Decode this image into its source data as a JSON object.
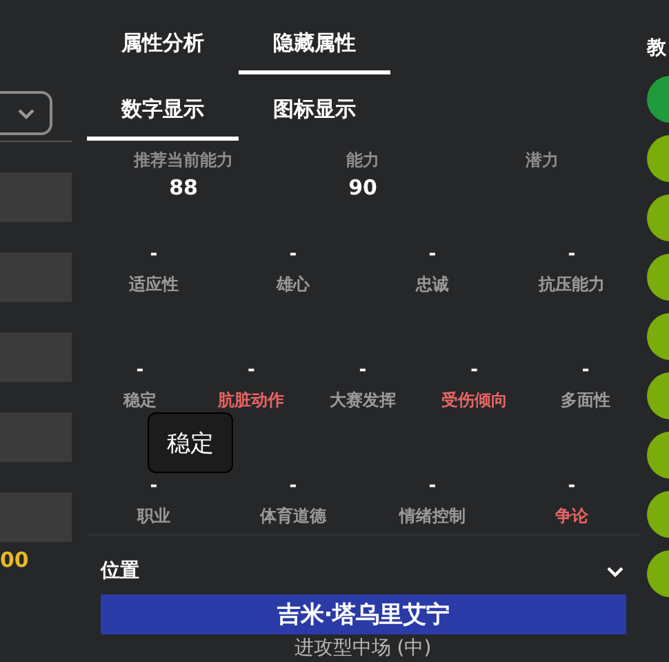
{
  "left_panel": {
    "dropdown": {
      "expanded": false
    },
    "amount": "00"
  },
  "tabs": [
    {
      "label": "属性分析",
      "selected": false
    },
    {
      "label": "隐藏属性",
      "selected": true
    }
  ],
  "view_tabs": [
    {
      "label": "数字显示",
      "selected": true
    },
    {
      "label": "图标显示",
      "selected": false
    }
  ],
  "ratings": [
    {
      "label": "推荐当前能力",
      "value": "88"
    },
    {
      "label": "能力",
      "value": "90"
    },
    {
      "label": "潜力"
    }
  ],
  "hidden_rows": [
    [
      {
        "label": "适应性",
        "value": "-",
        "color": "#9a9a9a"
      },
      {
        "label": "雄心",
        "value": "-",
        "color": "#9a9a9a"
      },
      {
        "label": "忠诚",
        "value": "-",
        "color": "#9a9a9a"
      },
      {
        "label": "抗压能力",
        "value": "-",
        "color": "#9a9a9a"
      }
    ],
    [
      {
        "label": "稳定",
        "value": "-",
        "color": "#9a9a9a"
      },
      {
        "label": "肮脏动作",
        "value": "-",
        "color": "#e86464"
      },
      {
        "label": "大赛发挥",
        "value": "-",
        "color": "#9a9a9a"
      },
      {
        "label": "受伤倾向",
        "value": "-",
        "color": "#e86464"
      },
      {
        "label": "多面性",
        "value": "-",
        "color": "#9a9a9a"
      }
    ],
    [
      {
        "label": "职业",
        "value": "-",
        "color": "#9a9a9a"
      },
      {
        "label": "体育道德",
        "value": "-",
        "color": "#9a9a9a"
      },
      {
        "label": "情绪控制",
        "value": "-",
        "color": "#9a9a9a"
      },
      {
        "label": "争论",
        "value": "-",
        "color": "#e86464"
      }
    ]
  ],
  "tooltip": "稳定",
  "position": {
    "title": "位置",
    "expanded": false,
    "player_name": "吉米·塔乌里艾宁",
    "role": "进攻型中场 (中)"
  },
  "right_panel": {
    "title": "教",
    "buttons": [
      {
        "color": "#1f9a3c"
      },
      {
        "color": "#7aad0c"
      },
      {
        "color": "#7aad0c"
      },
      {
        "color": "#7aad0c"
      },
      {
        "color": "#7aad0c"
      },
      {
        "color": "#7aad0c"
      },
      {
        "color": "#7aad0c"
      },
      {
        "color": "#7aad0c"
      },
      {
        "color": "#7aad0c"
      }
    ]
  }
}
